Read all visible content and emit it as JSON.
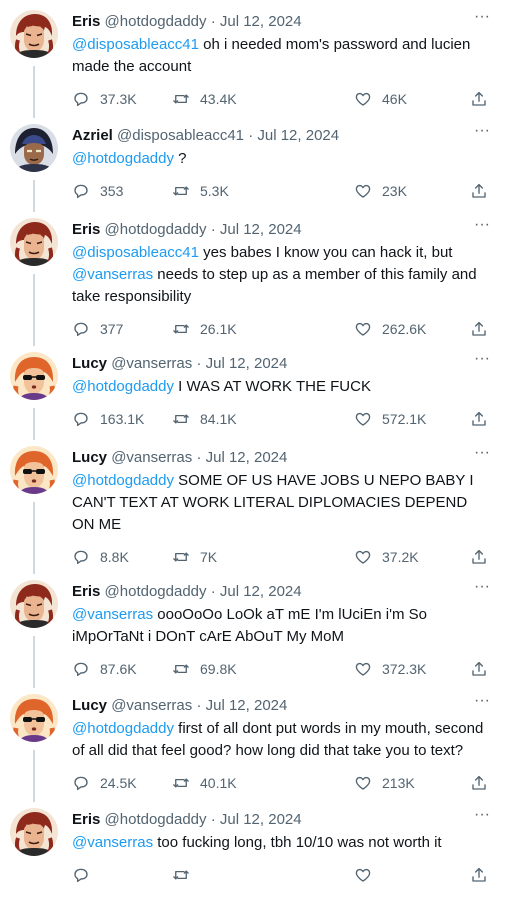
{
  "icons": {
    "reply": "reply-icon",
    "retweet": "retweet-icon",
    "like": "like-icon",
    "share": "share-icon",
    "more": "more-icon"
  },
  "colors": {
    "link": "#1d9bf0",
    "text": "#0f1419",
    "muted": "#536471",
    "thread_line": "#cfd9de"
  },
  "more_label": "···",
  "tweets": [
    {
      "name": "Eris",
      "handle": "@hotdogdaddy",
      "sep": "·",
      "date": "Jul 12, 2024",
      "mention": "@disposableacc41",
      "text": " oh i needed mom's password and lucien made the account",
      "stats": {
        "replies": "37.3K",
        "retweets": "43.4K",
        "likes": "46K"
      }
    },
    {
      "name": "Azriel",
      "handle": "@disposableacc41",
      "sep": "·",
      "date": "Jul 12, 2024",
      "mention": "@hotdogdaddy",
      "text": " ?",
      "stats": {
        "replies": "353",
        "retweets": "5.3K",
        "likes": "23K"
      }
    },
    {
      "name": "Eris",
      "handle": "@hotdogdaddy",
      "sep": "·",
      "date": "Jul 12, 2024",
      "mention": "@disposableacc41",
      "text": " yes babes I know you can hack it, but ",
      "mention2": "@vanserras",
      "text2": " needs to step up as a member of this family and take responsibility",
      "stats": {
        "replies": "377",
        "retweets": "26.1K",
        "likes": "262.6K"
      }
    },
    {
      "name": "Lucy",
      "handle": "@vanserras",
      "sep": "·",
      "date": "Jul 12, 2024",
      "mention": "@hotdogdaddy",
      "text": " I WAS AT WORK THE FUCK",
      "stats": {
        "replies": "163.1K",
        "retweets": "84.1K",
        "likes": "572.1K"
      }
    },
    {
      "name": "Lucy",
      "handle": "@vanserras",
      "sep": "·",
      "date": "Jul 12, 2024",
      "mention": "@hotdogdaddy",
      "text": " SOME OF US HAVE JOBS U NEPO BABY I CAN'T TEXT AT WORK LITERAL DIPLOMACIES DEPEND ON ME",
      "stats": {
        "replies": "8.8K",
        "retweets": "7K",
        "likes": "37.2K"
      }
    },
    {
      "name": "Eris",
      "handle": "@hotdogdaddy",
      "sep": "·",
      "date": "Jul 12, 2024",
      "mention": "@vanserras",
      "text": " oooOoOo LoOk aT mE I'm lUciEn i'm So iMpOrTaNt i DOnT cArE AbOuT My MoM",
      "stats": {
        "replies": "87.6K",
        "retweets": "69.8K",
        "likes": "372.3K"
      }
    },
    {
      "name": "Lucy",
      "handle": "@vanserras",
      "sep": "·",
      "date": "Jul 12, 2024",
      "mention": "@hotdogdaddy",
      "text": " first of all dont put words in my mouth, second of all did that feel good? how long did that take you to text?",
      "stats": {
        "replies": "24.5K",
        "retweets": "40.1K",
        "likes": "213K"
      }
    },
    {
      "name": "Eris",
      "handle": "@hotdogdaddy",
      "sep": "·",
      "date": "Jul 12, 2024",
      "mention": "@vanserras",
      "text": " too fucking long, tbh 10/10 was not worth it",
      "stats": {
        "replies": "",
        "retweets": "",
        "likes": ""
      }
    }
  ]
}
